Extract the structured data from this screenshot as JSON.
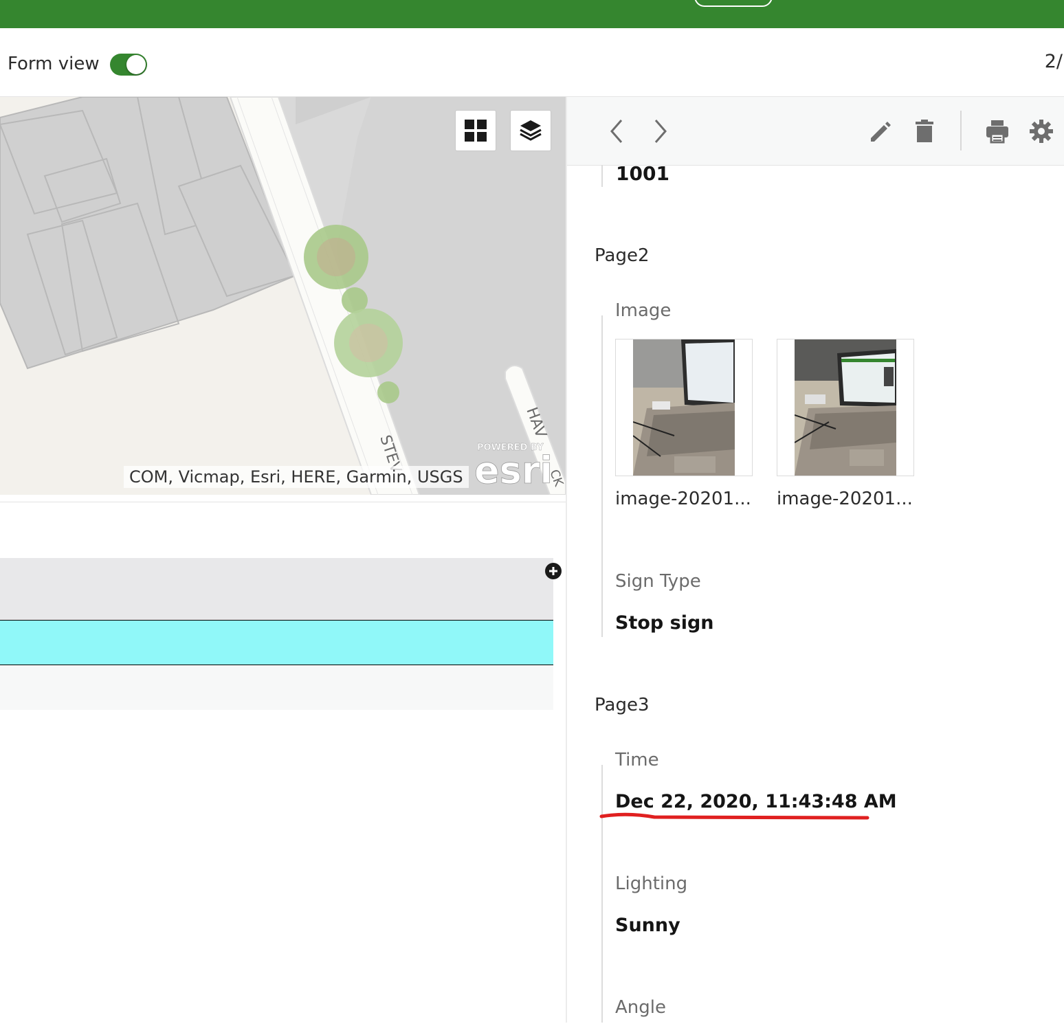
{
  "header": {
    "form_view_label": "Form view",
    "form_view_enabled": true,
    "record_counter": "2/"
  },
  "map": {
    "attribution": "COM, Vicmap, Esri, HERE, Garmin, USGS",
    "logo_text": "esri",
    "logo_powered": "POWERED BY",
    "street_labels": [
      "STEV",
      "HAV",
      "CK"
    ],
    "basemap_gallery_icon": "grid-icon",
    "layer_list_icon": "layers-icon"
  },
  "colors": {
    "brand_green": "#35862f",
    "selected_row": "#90f8f9",
    "annotation_red": "#e02020"
  },
  "popup": {
    "toolbar": {
      "prev_icon": "chevron-left-icon",
      "next_icon": "chevron-right-icon",
      "edit_icon": "pencil-icon",
      "delete_icon": "trash-icon",
      "print_icon": "printer-icon",
      "settings_icon": "gear-icon"
    },
    "top_value": "1001",
    "page2": {
      "title": "Page2",
      "image_label": "Image",
      "images": [
        {
          "caption": "image-20201..."
        },
        {
          "caption": "image-20201..."
        }
      ],
      "sign_type_label": "Sign Type",
      "sign_type_value": "Stop sign"
    },
    "page3": {
      "title": "Page3",
      "time_label": "Time",
      "time_value": "Dec 22, 2020, 11:43:48 AM",
      "lighting_label": "Lighting",
      "lighting_value": "Sunny",
      "angle_label": "Angle"
    }
  }
}
